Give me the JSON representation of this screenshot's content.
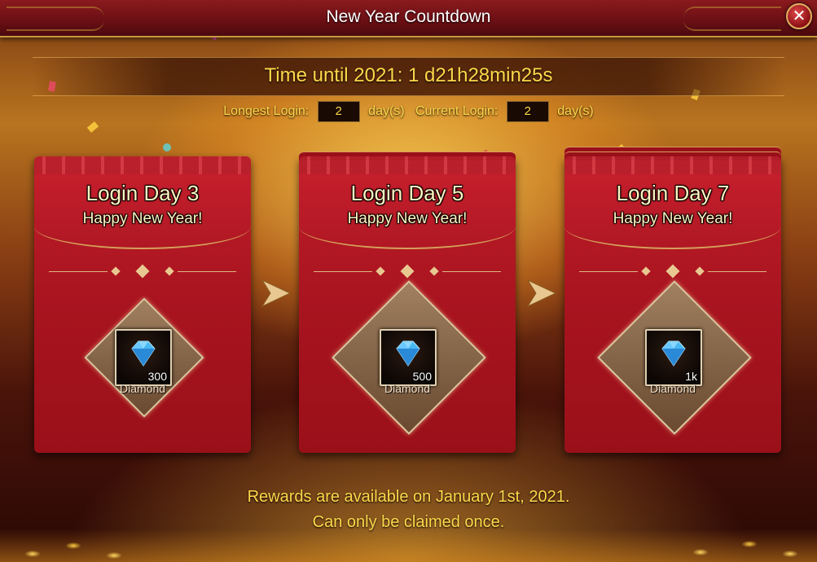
{
  "window": {
    "title": "New Year Countdown",
    "close_icon": "close-icon",
    "close_glyph": "✕"
  },
  "countdown": {
    "text": "Time until 2021: 1 d21h28min25s"
  },
  "login_stats": {
    "longest_label": "Longest Login:",
    "longest_value": "2",
    "longest_unit": "day(s)",
    "current_label": "Current Login:",
    "current_value": "2",
    "current_unit": "day(s)"
  },
  "cards": [
    {
      "title": "Login Day 3",
      "subtitle": "Happy New Year!",
      "reward": {
        "icon": "diamond-gem-icon",
        "qty": "300",
        "name": "Diamond"
      }
    },
    {
      "title": "Login Day 5",
      "subtitle": "Happy New Year!",
      "reward": {
        "icon": "diamond-gem-icon",
        "qty": "500",
        "name": "Diamond"
      }
    },
    {
      "title": "Login Day 7",
      "subtitle": "Happy New Year!",
      "reward": {
        "icon": "diamond-gem-icon",
        "qty": "1k",
        "name": "Diamond"
      }
    }
  ],
  "footer": {
    "line1": "Rewards are available on January 1st, 2021.",
    "line2": "Can only be claimed once."
  },
  "colors": {
    "accent_gold": "#ffd84a",
    "card_red": "#b01824",
    "title_bar": "#6a0f14"
  }
}
